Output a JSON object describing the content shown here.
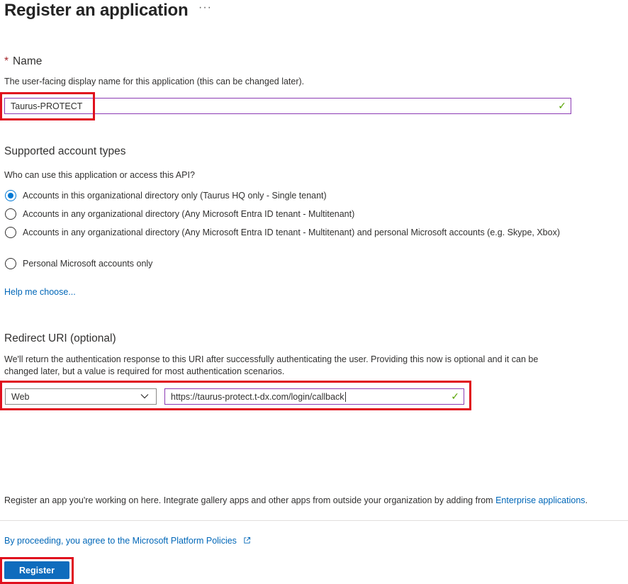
{
  "page": {
    "title": "Register an application",
    "more_label": "···"
  },
  "name_section": {
    "required_marker": "*",
    "heading": "Name",
    "description": "The user-facing display name for this application (this can be changed later).",
    "value": "Taurus-PROTECT"
  },
  "account_types": {
    "heading": "Supported account types",
    "question": "Who can use this application or access this API?",
    "options": [
      {
        "label": "Accounts in this organizational directory only (Taurus HQ only - Single tenant)",
        "selected": true
      },
      {
        "label": "Accounts in any organizational directory (Any Microsoft Entra ID tenant - Multitenant)",
        "selected": false
      },
      {
        "label": "Accounts in any organizational directory (Any Microsoft Entra ID tenant - Multitenant) and personal Microsoft accounts (e.g. Skype, Xbox)",
        "selected": false
      },
      {
        "label": "Personal Microsoft accounts only",
        "selected": false
      }
    ],
    "help_link": "Help me choose..."
  },
  "redirect": {
    "heading": "Redirect URI (optional)",
    "description": "We'll return the authentication response to this URI after successfully authenticating the user. Providing this now is optional and it can be changed later, but a value is required for most authentication scenarios.",
    "platform": "Web",
    "uri": "https://taurus-protect.t-dx.com/login/callback"
  },
  "footer": {
    "note_prefix": "Register an app you're working on here. Integrate gallery apps and other apps from outside your organization by adding from ",
    "note_link": "Enterprise applications",
    "note_suffix": ".",
    "policy_link": "By proceeding, you agree to the Microsoft Platform Policies",
    "register_label": "Register"
  },
  "colors": {
    "accent": "#0f6cbd",
    "link": "#0067b8",
    "highlight": "#e0101d",
    "valid_check": "#57a300",
    "required": "#a4262c"
  },
  "icons": [
    "more-icon",
    "checkmark-icon",
    "chevron-down-icon",
    "external-link-icon"
  ]
}
